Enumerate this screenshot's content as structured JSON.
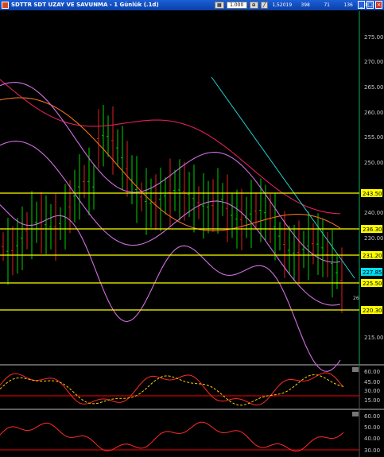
{
  "window": {
    "title": "SDTTR SDT UZAY VE SAVUNMA - 1 Günlük (.1d)",
    "toolbar": {
      "field_value": "1.000",
      "status_values": [
        "1,52019",
        "398",
        "71",
        "136",
        "892"
      ]
    },
    "window_buttons": [
      "minimize",
      "maximize",
      "close"
    ]
  },
  "price_axis": {
    "ticks": [
      "275.00",
      "270.00",
      "265.00",
      "260.00",
      "255.00",
      "250.00",
      "240.00",
      "230.00",
      "215.00"
    ],
    "level_boxes": [
      "243.50",
      "236.30",
      "231.20",
      "225.50",
      "220.30"
    ],
    "current_price": "227.85",
    "counter": "26"
  },
  "osc1": {
    "ticks": [
      "60.00",
      "45.00",
      "30.00",
      "15.00"
    ],
    "colors": {
      "line": "#ff2a2a",
      "signal": "#ffd000",
      "level": "#ff0000"
    }
  },
  "osc2": {
    "ticks": [
      "60.00",
      "50.00",
      "40.00",
      "30.00"
    ],
    "colors": {
      "line": "#ff2a2a",
      "level": "#ff0000"
    }
  },
  "colors": {
    "background": "#000000",
    "up_bar": "#00d000",
    "down_bar": "#e02020",
    "bollinger": "#d070e0",
    "ma_slow": "#e0205a",
    "ma_fast": "#f07020",
    "trendline": "#20d0d0",
    "level": "#ffff00"
  }
}
